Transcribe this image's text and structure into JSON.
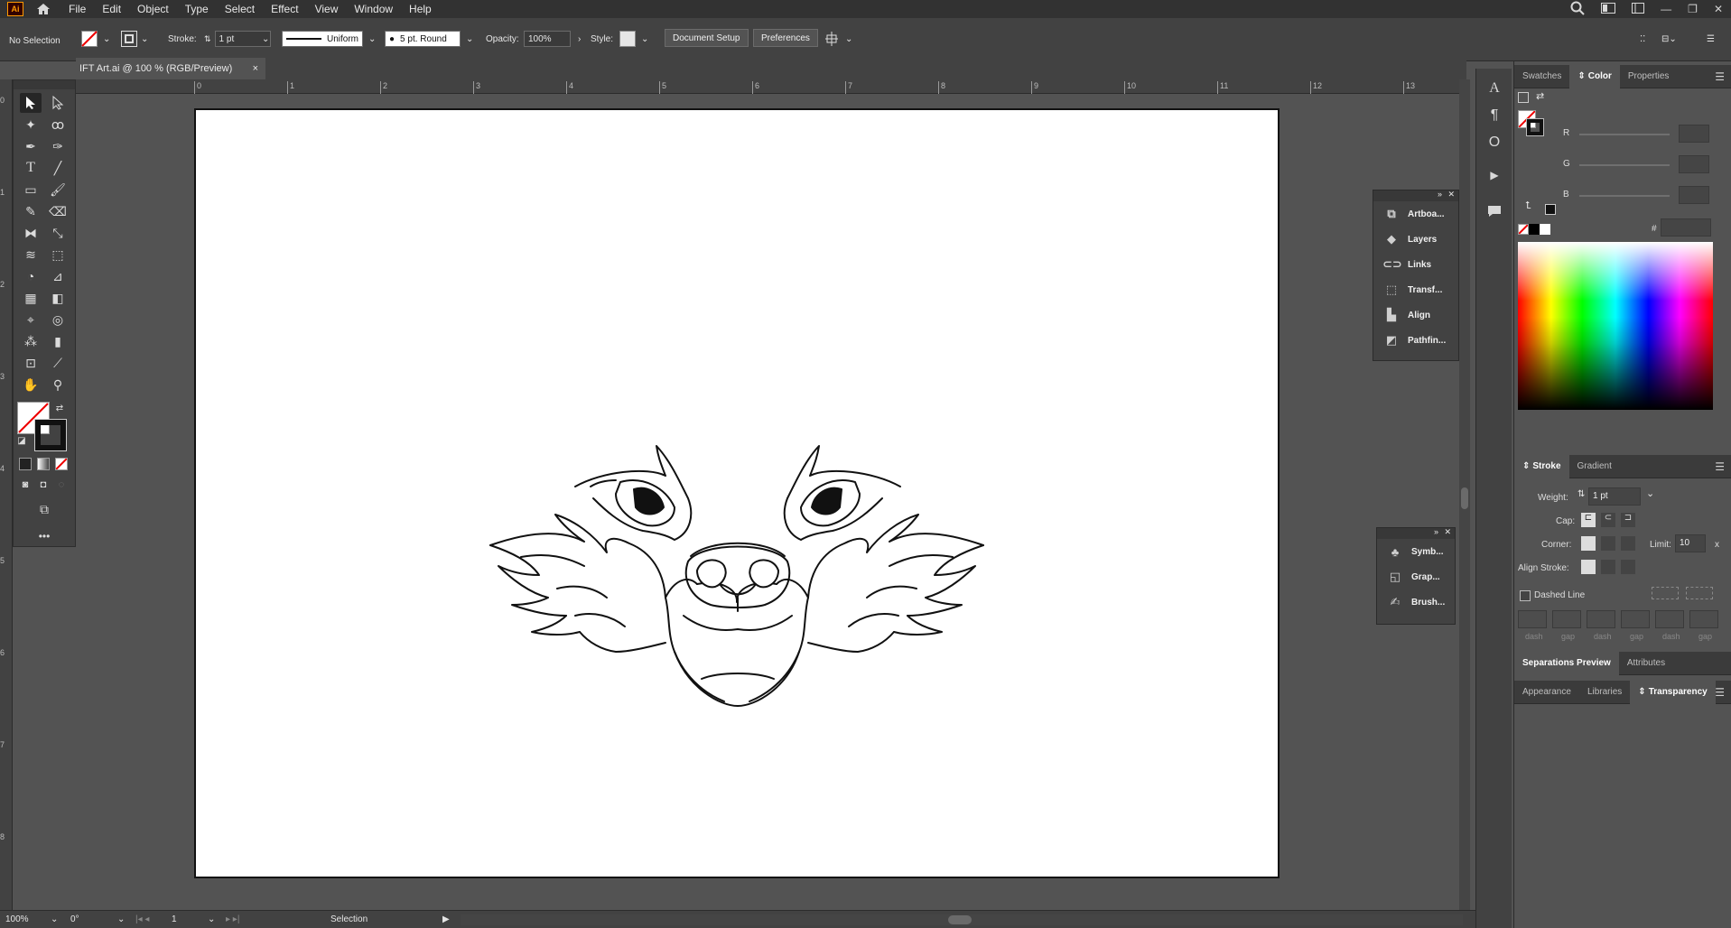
{
  "app": {
    "logo": "Ai",
    "menus": [
      "File",
      "Edit",
      "Object",
      "Type",
      "Select",
      "Effect",
      "View",
      "Window",
      "Help"
    ]
  },
  "control_bar": {
    "selection": "No Selection",
    "stroke_label": "Stroke:",
    "stroke_value": "1 pt",
    "profile": "Uniform",
    "brush": "5 pt. Round",
    "opacity_label": "Opacity:",
    "opacity_value": "100%",
    "style_label": "Style:",
    "document_setup": "Document Setup",
    "preferences": "Preferences"
  },
  "document": {
    "tab_title": "IFT Art.ai @ 100 % (RGB/Preview)",
    "tab_close": "×"
  },
  "rulers": {
    "horizontal": [
      "0",
      "1",
      "2",
      "3",
      "4",
      "5",
      "6",
      "7",
      "8",
      "9",
      "10",
      "11",
      "12",
      "13"
    ],
    "vertical": [
      "0",
      "1",
      "2",
      "3",
      "4",
      "5",
      "6",
      "7",
      "8"
    ]
  },
  "floating_panel_1": {
    "items": [
      {
        "label": "Artboa...",
        "icon": "artboards-icon"
      },
      {
        "label": "Layers",
        "icon": "layers-icon"
      },
      {
        "label": "Links",
        "icon": "links-icon"
      },
      {
        "label": "Transf...",
        "icon": "transform-icon"
      },
      {
        "label": "Align",
        "icon": "align-icon"
      },
      {
        "label": "Pathfin...",
        "icon": "pathfinder-icon"
      }
    ]
  },
  "floating_panel_2": {
    "items": [
      {
        "label": "Symb...",
        "icon": "symbols-icon"
      },
      {
        "label": "Grap...",
        "icon": "graphic-styles-icon"
      },
      {
        "label": "Brush...",
        "icon": "brushes-icon"
      }
    ]
  },
  "color_panel": {
    "tabs": [
      "Swatches",
      "Color",
      "Properties"
    ],
    "active_tab": "Color",
    "channels": [
      "R",
      "G",
      "B"
    ],
    "hex_prefix": "#"
  },
  "stroke_panel": {
    "tabs": [
      "Stroke",
      "Gradient"
    ],
    "weight_label": "Weight:",
    "weight_value": "1 pt",
    "cap_label": "Cap:",
    "corner_label": "Corner:",
    "limit_label": "Limit:",
    "limit_value": "10",
    "limit_unit": "x",
    "align_label": "Align Stroke:",
    "dashed_label": "Dashed Line",
    "dash_labels": [
      "dash",
      "gap",
      "dash",
      "gap",
      "dash",
      "gap"
    ]
  },
  "lower_tabs_1": [
    "Separations Preview",
    "Attributes"
  ],
  "lower_tabs_2": [
    "Appearance",
    "Libraries",
    "Transparency"
  ],
  "status": {
    "zoom": "100%",
    "rotation": "0°",
    "artboard": "1",
    "tool": "Selection"
  },
  "colors": {
    "ui_dark": "#323232",
    "ui_mid": "#424242",
    "canvas": "#535353",
    "artboard": "#ffffff",
    "brand": "#ff9a00"
  }
}
